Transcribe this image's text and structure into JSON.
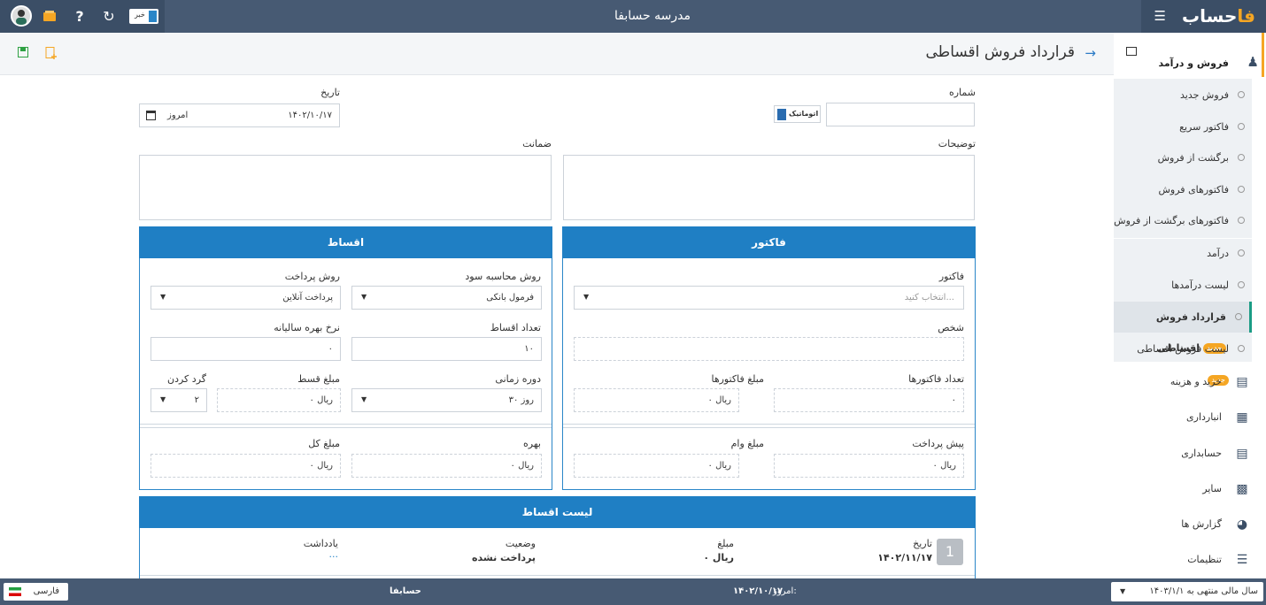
{
  "header": {
    "app_title": "مدرسه حسابفا",
    "brand_prefix": "حساب",
    "brand_suffix": "فا",
    "search_badge": "خبر"
  },
  "page": {
    "title": "قرارداد فروش اقساطی"
  },
  "form": {
    "number_label": "شماره",
    "auto_label": "اتوماتیک",
    "date_label": "تاریخ",
    "date_value": "۱۴۰۲/۱۰/۱۷",
    "today_label": "امروز",
    "description_label": "توضیحات",
    "guarantee_label": "ضمانت"
  },
  "invoice_panel": {
    "title": "فاکتور",
    "invoice_label": "فاکتور",
    "invoice_placeholder": "انتخاب کنید...",
    "person_label": "شخص",
    "invoice_count_label": "تعداد فاکتورها",
    "invoice_count_value": "۰",
    "invoice_amount_label": "مبلغ فاکتورها",
    "invoice_amount_value": "ریال ۰",
    "prepayment_label": "پیش پرداخت",
    "prepayment_value": "ریال ۰",
    "loan_amount_label": "مبلغ وام",
    "loan_amount_value": "ریال ۰"
  },
  "installment_panel": {
    "title": "اقساط",
    "profit_method_label": "روش محاسبه سود",
    "profit_method_value": "فرمول بانکی",
    "payment_method_label": "روش پرداخت",
    "payment_method_value": "پرداخت آنلاین",
    "count_label": "تعداد اقساط",
    "count_value": "۱۰",
    "rate_label": "نرخ بهره سالیانه",
    "rate_value": "۰",
    "period_label": "دوره زمانی",
    "period_value": "۳۰ روز",
    "amount_label": "مبلغ قسط",
    "amount_value": "ریال ۰",
    "round_label": "گرد کردن",
    "round_value": "۲",
    "interest_label": "بهره",
    "interest_value": "ریال ۰",
    "total_label": "مبلغ کل",
    "total_value": "ریال ۰"
  },
  "list_panel": {
    "title": "لیست اقساط",
    "row_number": "1",
    "date_label": "تاریخ",
    "date_value": "۱۴۰۲/۱۱/۱۷",
    "amount_label": "مبلغ",
    "amount_value": "ریال ۰",
    "status_label": "وضعیت",
    "status_value": "پرداخت نشده",
    "note_label": "یادداشت",
    "note_value": "..."
  },
  "sidebar": {
    "section": "فروش و درآمد",
    "new_badge": "جدید",
    "items": [
      {
        "label": "فروش جدید"
      },
      {
        "label": "فاکتور سریع"
      },
      {
        "label": "برگشت از فروش"
      },
      {
        "label": "فاکتورهای فروش"
      },
      {
        "label": "فاکتورهای برگشت از فروش"
      },
      {
        "label": "درآمد"
      },
      {
        "label": "لیست درآمدها"
      },
      {
        "label": "قرارداد فروش اقساطی"
      },
      {
        "label": "لیست فروش اقساطی"
      }
    ],
    "mains": [
      {
        "label": "خرید و هزینه"
      },
      {
        "label": "انبارداری"
      },
      {
        "label": "حسابداری"
      },
      {
        "label": "سایر"
      },
      {
        "label": "گزارش ها"
      },
      {
        "label": "تنظیمات"
      }
    ]
  },
  "footer": {
    "fiscal_year": "سال مالی منتهی به ۱۴۰۳/۱/۱",
    "today_label": "امروز:",
    "today_value": "۱۴۰۲/۱۰/۱۷",
    "company": "حسابفا",
    "language": "فارسی"
  },
  "colors": {
    "topbar": "#475a73",
    "panel_header": "#1f7fc4",
    "accent": "#f5a623"
  }
}
